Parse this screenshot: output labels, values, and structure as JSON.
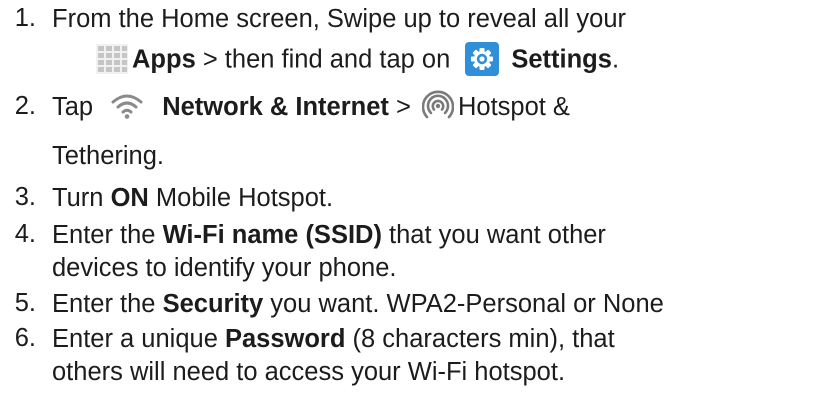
{
  "steps": [
    {
      "num": "1.",
      "line1": "From the Home screen, Swipe up to reveal all your",
      "apps_label": "Apps",
      "mid": " > then find and tap on ",
      "settings_label": "Settings",
      "end": "."
    },
    {
      "num": "2.",
      "pre": "Tap ",
      "network_label": "Network & Internet",
      "mid": " > ",
      "hotspot_text": "Hotspot &",
      "line2": "Tethering."
    },
    {
      "num": "3.",
      "pre": "Turn ",
      "bold": "ON",
      "post": " Mobile Hotspot."
    },
    {
      "num": "4.",
      "pre": "Enter the ",
      "bold": "Wi-Fi name (SSID)",
      "post": " that you want other",
      "line2": "devices to identify your phone."
    },
    {
      "num": "5.",
      "pre": "Enter the ",
      "bold": "Security",
      "post": " you want. WPA2-Personal or None"
    },
    {
      "num": "6.",
      "pre": "Enter a unique ",
      "bold": "Password",
      "post": " (8 characters min), that",
      "line2": "others will need to access your Wi-Fi hotspot."
    }
  ],
  "icons": {
    "apps": "apps-grid-icon",
    "settings": "settings-gear-icon",
    "network": "wifi-icon",
    "hotspot": "hotspot-icon"
  },
  "colors": {
    "text": "#1c1c1c",
    "settings_icon_bg": "#2f8fd8",
    "icon_gray": "#8a8a8a"
  }
}
